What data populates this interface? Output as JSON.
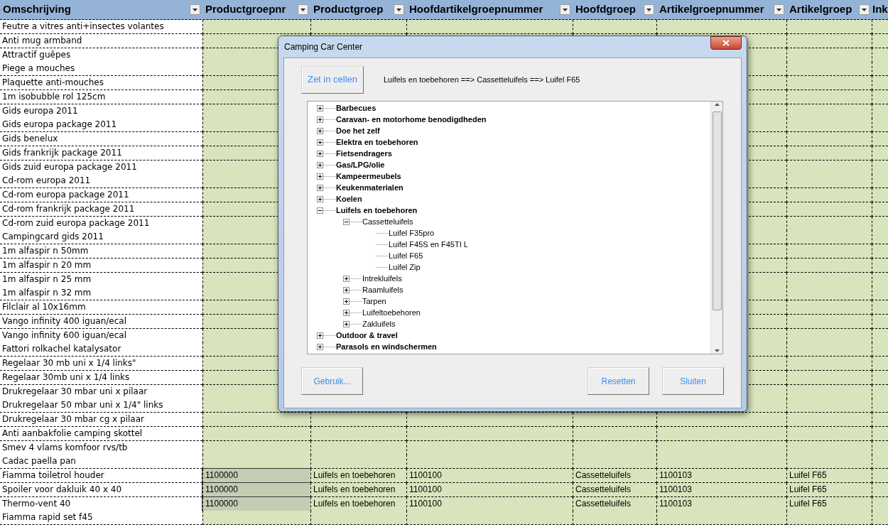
{
  "sheet": {
    "columns": [
      {
        "label": "Omschrijving"
      },
      {
        "label": "Productgroepnr"
      },
      {
        "label": "Productgroep"
      },
      {
        "label": "Hoofdartikelgroepnummer"
      },
      {
        "label": "Hoofdgroep"
      },
      {
        "label": "Artikelgroepnummer"
      },
      {
        "label": "Artikelgroep"
      },
      {
        "label": "Ink"
      }
    ],
    "rows": [
      {
        "description": "Feutre a vitres anti+insectes volantes",
        "selected": false
      },
      {
        "description": "Anti mug armband",
        "selected": false
      },
      {
        "description": "Attractif guêpes",
        "selected": false
      },
      {
        "description": "Piege a mouches",
        "selected": false
      },
      {
        "description": "Plaquette anti-mouches",
        "selected": false
      },
      {
        "description": "1m isobubble rol 125cm",
        "selected": false
      },
      {
        "description": "Gids europa 2011",
        "selected": false
      },
      {
        "description": "Gids europa package 2011",
        "selected": false
      },
      {
        "description": "Gids benelux",
        "selected": false
      },
      {
        "description": "Gids frankrijk package 2011",
        "selected": false
      },
      {
        "description": "Gids zuid europa package 2011",
        "selected": false
      },
      {
        "description": "Cd-rom europa 2011",
        "selected": false
      },
      {
        "description": "Cd-rom europa package 2011",
        "selected": false
      },
      {
        "description": "Cd-rom frankrijk package 2011",
        "selected": false
      },
      {
        "description": "Cd-rom zuid europa package 2011",
        "selected": false
      },
      {
        "description": "Campingcard gids 2011",
        "selected": false
      },
      {
        "description": "1m alfaspir  n 50mm",
        "selected": false
      },
      {
        "description": "1m alfaspir  n 20 mm",
        "selected": false
      },
      {
        "description": "1m alfaspir  n 25 mm",
        "selected": false
      },
      {
        "description": "1m alfaspir  n 32 mm",
        "selected": false
      },
      {
        "description": "Filclair al 10x16mm",
        "selected": false
      },
      {
        "description": "Vango infinity 400 iguan/ecal",
        "selected": false
      },
      {
        "description": "Vango infinity 600 iguan/ecal",
        "selected": false
      },
      {
        "description": "Fattori rolkachel katalysator",
        "selected": false
      },
      {
        "description": "Regelaar 30 mb uni x 1/4 links\"",
        "selected": false
      },
      {
        "description": "Regelaar 30mb uni x 1/4 links",
        "selected": false
      },
      {
        "description": "Drukregelaar 30 mbar uni x pilaar",
        "selected": false
      },
      {
        "description": "Drukregelaar 50 mbar uni x 1/4\" links",
        "selected": false
      },
      {
        "description": "Drukregelaar 30 mbar cg x pilaar",
        "selected": false
      },
      {
        "description": "Anti aanbakfolie camping skottel",
        "selected": false
      },
      {
        "description": "Smev 4 vlams komfoor rvs/tb",
        "selected": false
      },
      {
        "description": "Cadac paella pan",
        "selected": false
      },
      {
        "description": "Fiamma toiletrol houder",
        "selected": true,
        "cells": [
          "1100000",
          "Luifels en toebehoren",
          "1100100",
          "Cassetteluifels",
          "1100103",
          "Luifel F65"
        ]
      },
      {
        "description": "Spoiler voor dakluik 40 x 40",
        "selected": true,
        "cells": [
          "1100000",
          "Luifels en toebehoren",
          "1100100",
          "Cassetteluifels",
          "1100103",
          "Luifel F65"
        ]
      },
      {
        "description": "Thermo-vent 40",
        "selected": true,
        "cells": [
          "1100000",
          "Luifels en toebehoren",
          "1100100",
          "Cassetteluifels",
          "1100103",
          "Luifel F65"
        ]
      },
      {
        "description": "Fiamma rapid set f45",
        "selected": false
      }
    ]
  },
  "dialog": {
    "title": "Camping Car Center",
    "top_button": "Zet in cellen",
    "path": "Luifels en toebehoren ==> Cassetteluifels ==> Luifel F65",
    "tree": [
      {
        "label": "Barbecues",
        "expanded": false
      },
      {
        "label": "Caravan- en motorhome benodigdheden",
        "expanded": false
      },
      {
        "label": "Doe het zelf",
        "expanded": false
      },
      {
        "label": "Elektra en toebehoren",
        "expanded": false
      },
      {
        "label": "Fietsendragers",
        "expanded": false
      },
      {
        "label": "Gas/LPG/olie",
        "expanded": false
      },
      {
        "label": "Kampeermeubels",
        "expanded": false
      },
      {
        "label": "Keukenmaterialen",
        "expanded": false
      },
      {
        "label": "Koelen",
        "expanded": false
      },
      {
        "label": "Luifels en toebehoren",
        "expanded": true,
        "children": [
          {
            "label": "Cassetteluifels",
            "expanded": true,
            "children": [
              {
                "label": "Luifel F35pro"
              },
              {
                "label": "Luifel F45S en F45TI L"
              },
              {
                "label": "Luifel F65"
              },
              {
                "label": "Luifel Zip"
              }
            ]
          },
          {
            "label": "Intrekluifels",
            "expanded": false
          },
          {
            "label": "Raamluifels",
            "expanded": false
          },
          {
            "label": "Tarpen",
            "expanded": false
          },
          {
            "label": "Luifeltoebehoren",
            "expanded": false
          },
          {
            "label": "Zakluifels",
            "expanded": false
          }
        ]
      },
      {
        "label": "Outdoor & travel",
        "expanded": false
      },
      {
        "label": "Parasols en windschermen",
        "expanded": false
      }
    ],
    "buttons": [
      "Gebruik...",
      "Resetten",
      "Sluiten"
    ]
  }
}
